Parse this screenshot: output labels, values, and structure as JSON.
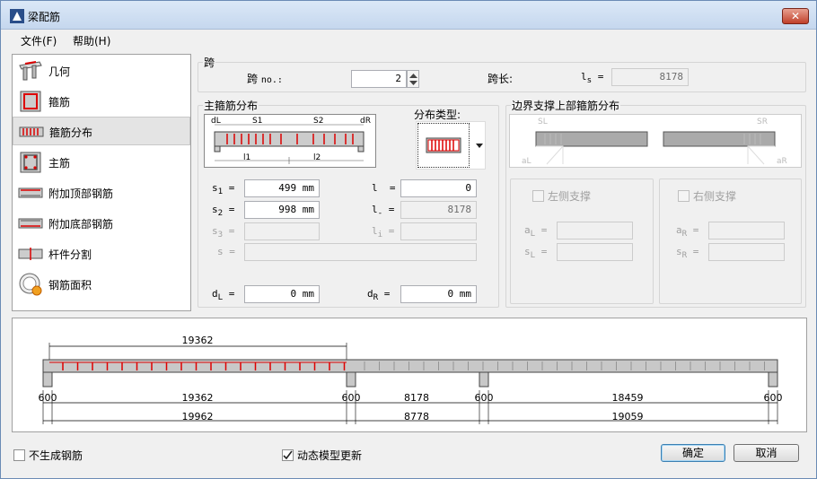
{
  "window": {
    "title": "梁配筋",
    "close_glyph": "✕"
  },
  "menu": {
    "file": "文件(F)",
    "help": "帮助(H)"
  },
  "sidebar": {
    "items": [
      {
        "label": "几何",
        "icon": "geometry-icon"
      },
      {
        "label": "箍筋",
        "icon": "stirrup-icon"
      },
      {
        "label": "箍筋分布",
        "icon": "stirrup-distribution-icon",
        "selected": true
      },
      {
        "label": "主筋",
        "icon": "main-bar-icon"
      },
      {
        "label": "附加顶部钢筋",
        "icon": "additional-top-bar-icon"
      },
      {
        "label": "附加底部钢筋",
        "icon": "additional-bottom-bar-icon"
      },
      {
        "label": "杆件分割",
        "icon": "member-split-icon"
      },
      {
        "label": "钢筋面积",
        "icon": "rebar-area-icon"
      }
    ]
  },
  "span_group": {
    "title": "跨",
    "span_label": "跨",
    "span_no_suffix": "no.:",
    "span_value": "2",
    "length_label": "跨长:",
    "ls_label": "l",
    "ls_sub": "s",
    "ls_eq": "=",
    "ls_value": "8178"
  },
  "main_stirrup": {
    "title": "主箍筋分布",
    "dist_type_label": "分布类型:",
    "fig": {
      "dL": "dL",
      "s1": "S1",
      "s2": "S2",
      "dR": "dR",
      "l1": "l1",
      "l2": "l2"
    },
    "s1_label": "s",
    "s1_sub": "1",
    "s1_value": "499 mm",
    "s2_label": "s",
    "s2_sub": "2",
    "s2_value": "998 mm",
    "s3_label": "s",
    "s3_sub": "3",
    "s3_value": "",
    "s_label": "s",
    "s_value": "",
    "l_label": "l",
    "l_value": "0",
    "l_dash_label": "l",
    "l_dash_sub": "-",
    "l_dash_value": "8178",
    "li_label": "l",
    "li_sub": "i",
    "li_value": "",
    "eq": "=",
    "dL_label": "d",
    "dL_sub": "L",
    "dL_value": "0 mm",
    "dR_label": "d",
    "dR_sub": "R",
    "dR_value": "0 mm"
  },
  "boundary": {
    "title": "边界支撑上部箍筋分布",
    "fig": {
      "sL": "SL",
      "sR": "SR",
      "aL": "aL",
      "aR": "aR"
    },
    "left_support": "左侧支撑",
    "right_support": "右侧支撑",
    "aL_label": "a",
    "aL_sub": "L",
    "sL_label": "s",
    "sL_sub": "L",
    "aR_label": "a",
    "aR_sub": "R",
    "sR_label": "s",
    "sR_sub": "R"
  },
  "bottom": {
    "no_rebar": "不生成钢筋",
    "dynamic_update": "动态模型更新",
    "ok": "确定",
    "cancel": "取消"
  },
  "beam_diagram": {
    "top_dim": "19362",
    "supports": [
      "600",
      "600",
      "600",
      "600"
    ],
    "clear_spans": [
      "19362",
      "8178",
      "18459"
    ],
    "total_spans": [
      "19962",
      "8778",
      "19059"
    ]
  },
  "colors": {
    "rebar": "#e01010",
    "beam": "#c0c0c0"
  }
}
